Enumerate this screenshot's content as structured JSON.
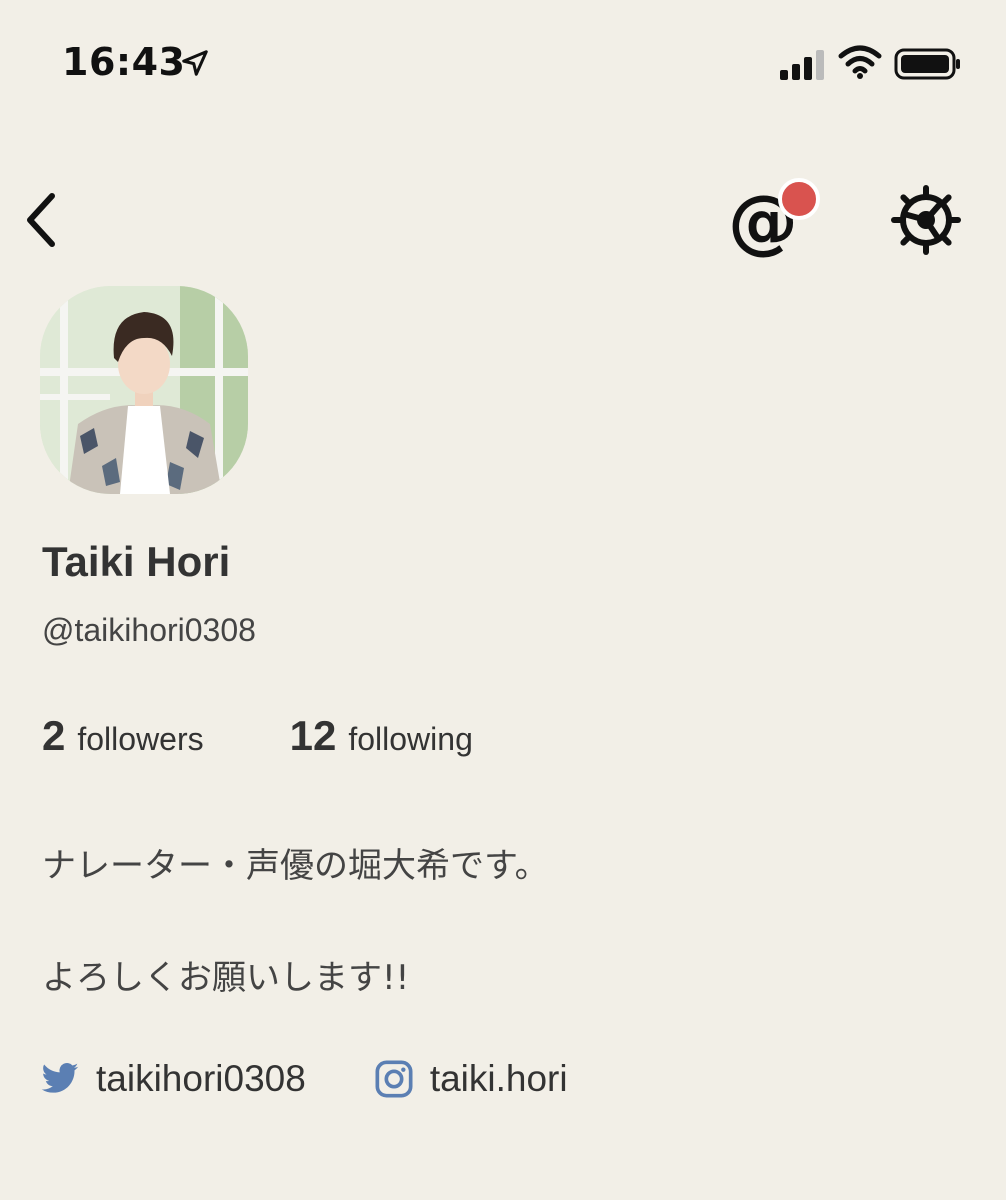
{
  "status_bar": {
    "time": "16:43",
    "icons": [
      "location-arrow-icon",
      "cellular-signal-icon",
      "wifi-icon",
      "battery-icon"
    ]
  },
  "nav": {
    "back_icon": "chevron-left-icon",
    "mentions_glyph": "@",
    "mentions_has_notification": true,
    "settings_icon": "gear-icon"
  },
  "profile": {
    "display_name": "Taiki Hori",
    "username": "@taikihori0308",
    "followers_count": "2",
    "followers_label": "followers",
    "following_count": "12",
    "following_label": "following",
    "bio_line_1": "ナレーター・声優の堀大希です。",
    "bio_line_2": "よろしくお願いします!!"
  },
  "social": {
    "twitter_handle": "taikihori0308",
    "instagram_handle": "taiki.hori"
  },
  "colors": {
    "background": "#f2efe7",
    "notification_dot": "#d9534f",
    "social_icon": "#5b7fb3",
    "text_primary": "#333333"
  }
}
